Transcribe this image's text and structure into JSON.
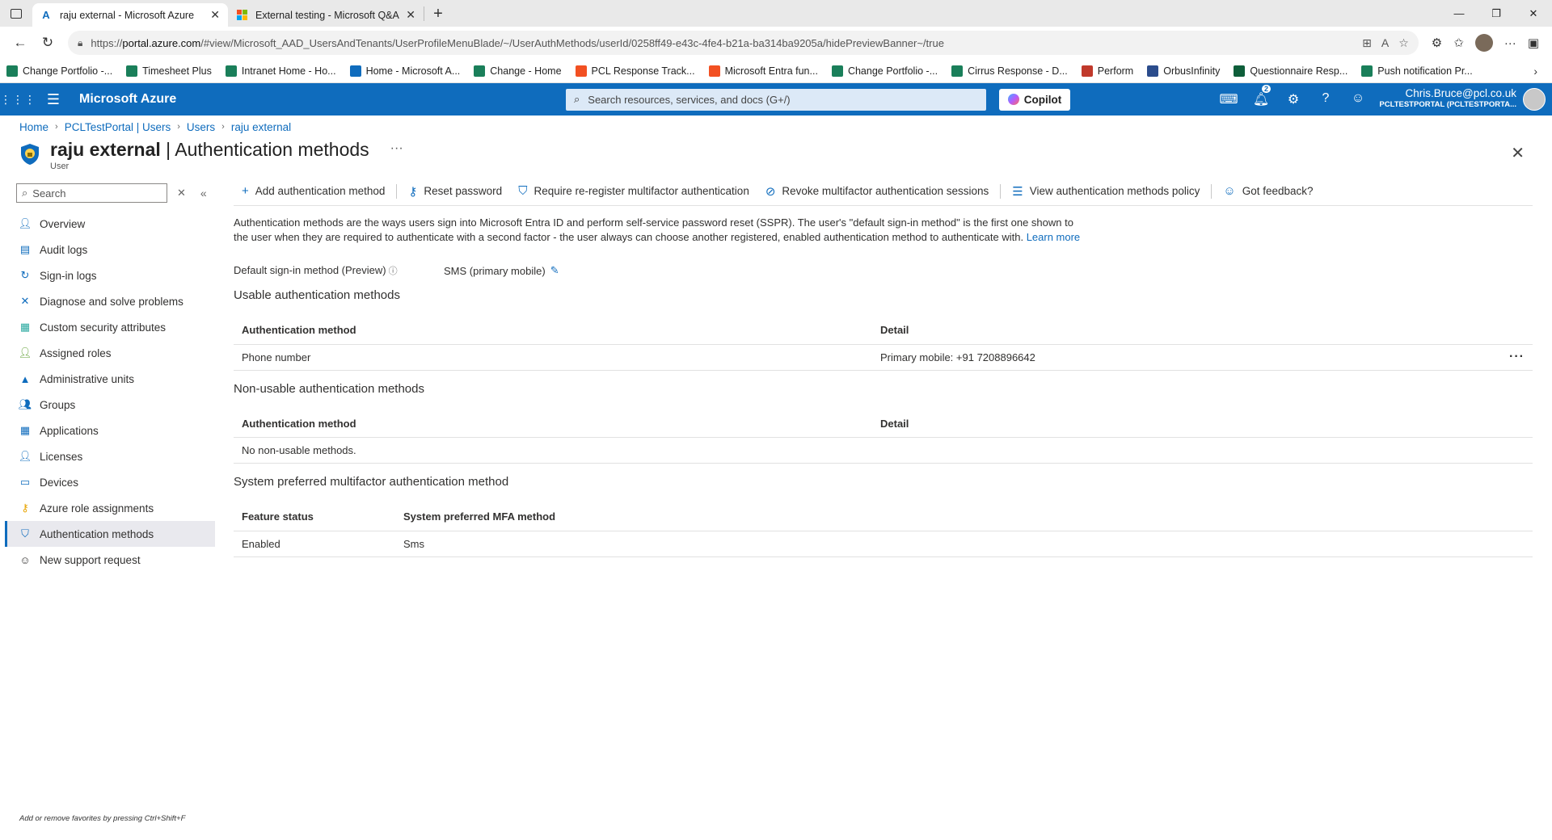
{
  "browser": {
    "tabs": [
      {
        "title": "raju external - Microsoft Azure",
        "active": true
      },
      {
        "title": "External testing - Microsoft Q&A",
        "active": false
      }
    ],
    "url": {
      "prefix": "https://",
      "host": "portal.azure.com",
      "path": "/#view/Microsoft_AAD_UsersAndTenants/UserProfileMenuBlade/~/UserAuthMethods/userId/0258ff49-e43c-4fe4-b21a-ba314ba9205a/hidePreviewBanner~/true"
    },
    "bookmarks": [
      {
        "label": "Change Portfolio -...",
        "color": "#1a7f5a"
      },
      {
        "label": "Timesheet Plus",
        "color": "#1a7f5a"
      },
      {
        "label": "Intranet Home - Ho...",
        "color": "#1a7f5a"
      },
      {
        "label": "Home - Microsoft A...",
        "color": "#0f6cbd"
      },
      {
        "label": "Change - Home",
        "color": "#1a7f5a"
      },
      {
        "label": "PCL Response Track...",
        "color": "#f25022"
      },
      {
        "label": "Microsoft Entra fun...",
        "color": "#f25022"
      },
      {
        "label": "Change Portfolio -...",
        "color": "#1a7f5a"
      },
      {
        "label": "Cirrus Response - D...",
        "color": "#1a7f5a"
      },
      {
        "label": "Perform",
        "color": "#c0392b"
      },
      {
        "label": "OrbusInfinity",
        "color": "#2b4c8c"
      },
      {
        "label": "Questionnaire Resp...",
        "color": "#0e5e3a"
      },
      {
        "label": "Push notification Pr...",
        "color": "#1a7f5a"
      }
    ]
  },
  "azure": {
    "brand": "Microsoft Azure",
    "search_placeholder": "Search resources, services, and docs (G+/)",
    "copilot_label": "Copilot",
    "notification_count": "2",
    "user_email": "Chris.Bruce@pcl.co.uk",
    "tenant": "PCLTESTPORTAL (PCLTESTPORTA..."
  },
  "breadcrumb": [
    "Home",
    "PCLTestPortal | Users",
    "Users",
    "raju external"
  ],
  "page": {
    "title_name": "raju external",
    "title_section": " | Authentication methods",
    "subtitle": "User",
    "more": "···"
  },
  "sidebar": {
    "search_placeholder": "Search",
    "items": [
      {
        "label": "Overview",
        "icon": "person-icon",
        "color": "#0f6cbd"
      },
      {
        "label": "Audit logs",
        "icon": "log-icon",
        "color": "#0f6cbd"
      },
      {
        "label": "Sign-in logs",
        "icon": "signin-icon",
        "color": "#0f6cbd"
      },
      {
        "label": "Diagnose and solve problems",
        "icon": "wrench-icon",
        "color": "#0f6cbd"
      },
      {
        "label": "Custom security attributes",
        "icon": "attributes-icon",
        "color": "#2aa9a0"
      },
      {
        "label": "Assigned roles",
        "icon": "roles-icon",
        "color": "#5c9e2e"
      },
      {
        "label": "Administrative units",
        "icon": "units-icon",
        "color": "#0f6cbd"
      },
      {
        "label": "Groups",
        "icon": "groups-icon",
        "color": "#0f6cbd"
      },
      {
        "label": "Applications",
        "icon": "apps-icon",
        "color": "#0f6cbd"
      },
      {
        "label": "Licenses",
        "icon": "licenses-icon",
        "color": "#0f6cbd"
      },
      {
        "label": "Devices",
        "icon": "devices-icon",
        "color": "#0f6cbd"
      },
      {
        "label": "Azure role assignments",
        "icon": "key-icon",
        "color": "#e8a400"
      },
      {
        "label": "Authentication methods",
        "icon": "shield-icon",
        "color": "#0f6cbd",
        "selected": true
      },
      {
        "label": "New support request",
        "icon": "support-icon",
        "color": "#323130"
      }
    ],
    "footer_hint": "Add or remove favorites by pressing Ctrl+Shift+F"
  },
  "toolbar": {
    "add": "Add authentication method",
    "reset": "Reset password",
    "require": "Require re-register multifactor authentication",
    "revoke": "Revoke multifactor authentication sessions",
    "view_policy": "View authentication methods policy",
    "feedback": "Got feedback?"
  },
  "description": {
    "text": "Authentication methods are the ways users sign into Microsoft Entra ID and perform self-service password reset (SSPR). The user's \"default sign-in method\" is the first one shown to the user when they are required to authenticate with a second factor - the user always can choose another registered, enabled authentication method to authenticate with.",
    "link": "Learn more"
  },
  "default_method": {
    "label": "Default sign-in method (Preview)",
    "value": "SMS (primary mobile)"
  },
  "usable": {
    "title": "Usable authentication methods",
    "headers": [
      "Authentication method",
      "Detail"
    ],
    "rows": [
      [
        "Phone number",
        "Primary mobile: +91 7208896642"
      ]
    ]
  },
  "non_usable": {
    "title": "Non-usable authentication methods",
    "headers": [
      "Authentication method",
      "Detail"
    ],
    "rows": [
      [
        "No non-usable methods.",
        ""
      ]
    ]
  },
  "system_preferred": {
    "title": "System preferred multifactor authentication method",
    "headers": [
      "Feature status",
      "System preferred MFA method"
    ],
    "rows": [
      [
        "Enabled",
        "Sms"
      ]
    ]
  }
}
